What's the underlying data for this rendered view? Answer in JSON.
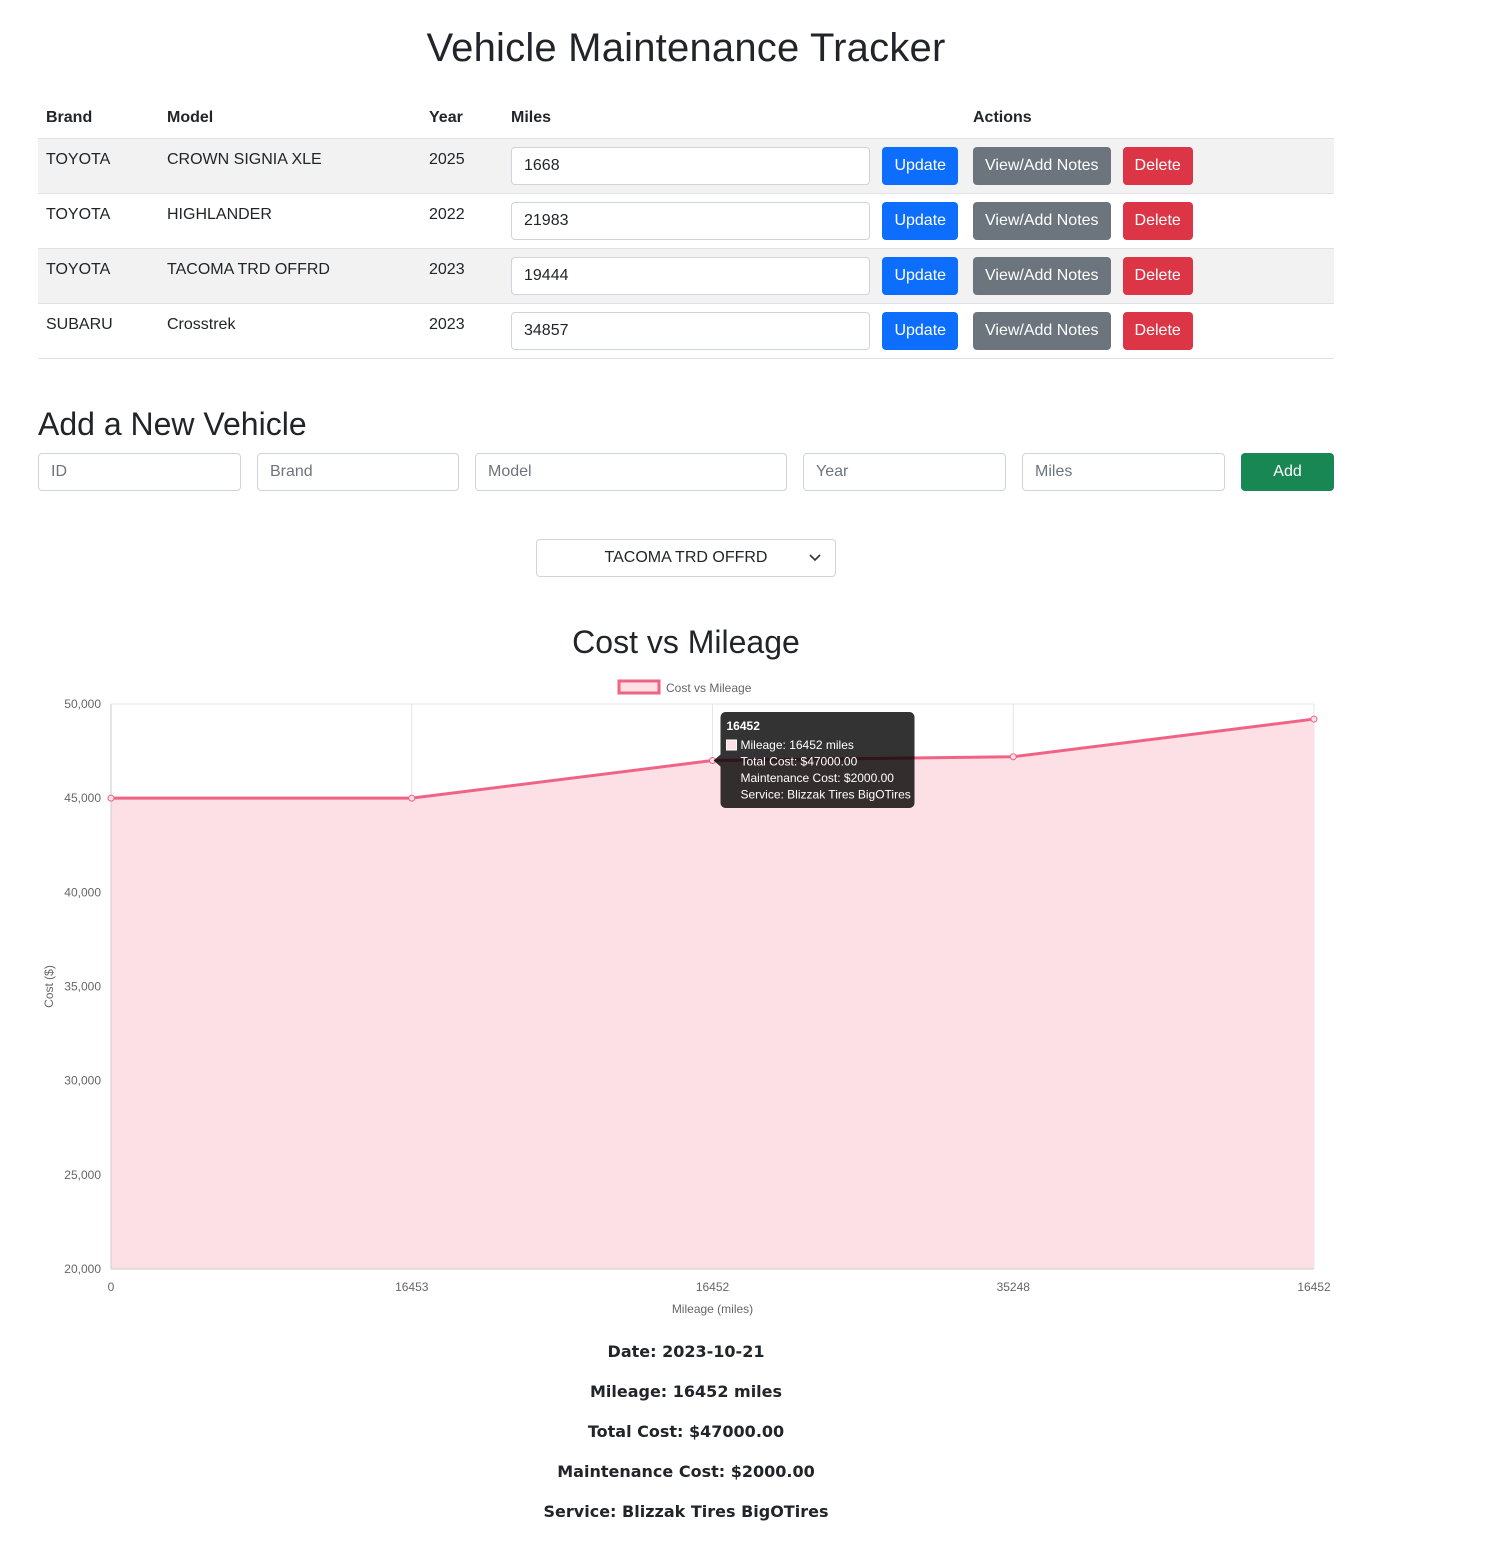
{
  "title": "Vehicle Maintenance Tracker",
  "table": {
    "headers": {
      "brand": "Brand",
      "model": "Model",
      "year": "Year",
      "miles": "Miles",
      "actions": "Actions"
    },
    "rows": [
      {
        "brand": "TOYOTA",
        "model": "CROWN SIGNIA XLE",
        "year": "2025",
        "miles": "1668"
      },
      {
        "brand": "TOYOTA",
        "model": "HIGHLANDER",
        "year": "2022",
        "miles": "21983"
      },
      {
        "brand": "TOYOTA",
        "model": "TACOMA TRD OFFRD",
        "year": "2023",
        "miles": "19444"
      },
      {
        "brand": "SUBARU",
        "model": "Crosstrek",
        "year": "2023",
        "miles": "34857"
      }
    ],
    "buttons": {
      "update": "Update",
      "notes": "View/Add Notes",
      "delete": "Delete"
    }
  },
  "add_vehicle": {
    "heading": "Add a New Vehicle",
    "placeholders": {
      "id": "ID",
      "brand": "Brand",
      "model": "Model",
      "year": "Year",
      "miles": "Miles"
    },
    "add_label": "Add"
  },
  "vehicle_select": {
    "selected": "TACOMA TRD OFFRD"
  },
  "chart_heading": "Cost vs Mileage",
  "chart_data": {
    "type": "line",
    "legend": "Cost vs Mileage",
    "legend_position": "top-center",
    "categories": [
      "0",
      "16453",
      "16452",
      "35248",
      "16452"
    ],
    "series": [
      {
        "name": "Cost vs Mileage",
        "values": [
          45000,
          45000,
          47000,
          47200,
          49200
        ]
      }
    ],
    "xlabel": "Mileage (miles)",
    "ylabel": "Cost ($)",
    "ylim": [
      20000,
      50000
    ],
    "yticks": [
      "50,000",
      "45,000",
      "40,000",
      "35,000",
      "30,000",
      "25,000",
      "20,000"
    ],
    "grid": true,
    "fill": true,
    "line_color": "#f06384",
    "fill_color": "#fde0e6",
    "tooltip": {
      "title": "16452",
      "lines": [
        "Mileage: 16452 miles",
        "Total Cost: $47000.00",
        "Maintenance Cost: $2000.00",
        "Service: Blizzak Tires BigOTires"
      ]
    }
  },
  "details": {
    "date_label": "Date:",
    "date": "2023-10-21",
    "mileage_label": "Mileage:",
    "mileage": "16452 miles",
    "total_label": "Total Cost:",
    "total": "$47000.00",
    "maint_label": "Maintenance Cost:",
    "maint": "$2000.00",
    "service_label": "Service:",
    "service": "Blizzak Tires BigOTires"
  },
  "colors": {
    "update": "#0d6efd",
    "notes": "#6c757d",
    "delete": "#dc3545",
    "add": "#198754"
  }
}
